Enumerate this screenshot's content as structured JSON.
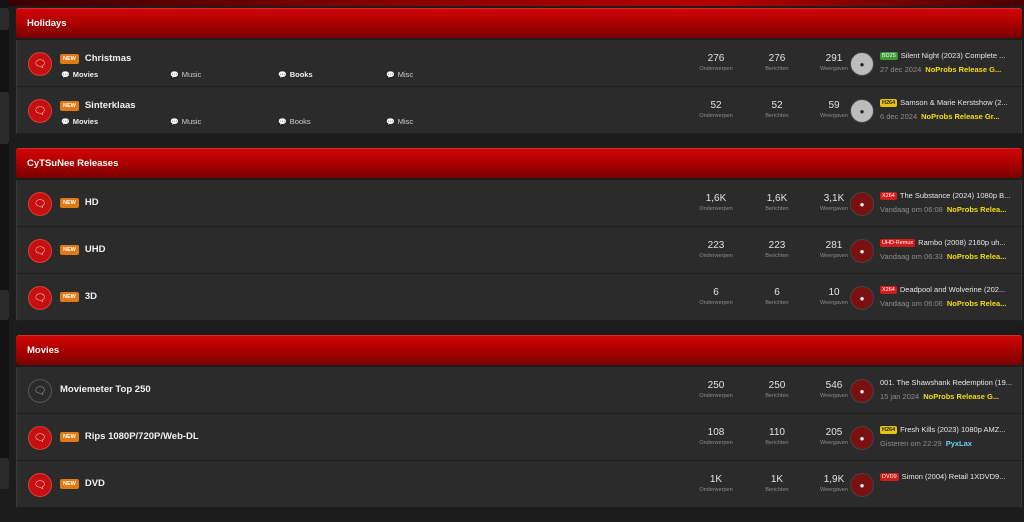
{
  "labels": {
    "topics": "Onderwerpen",
    "posts": "Berichten",
    "views": "Weergaven"
  },
  "categories": [
    {
      "title": "Holidays",
      "nodes": [
        {
          "title": "Christmas",
          "new": "NEW",
          "topics": "276",
          "posts": "276",
          "views": "291",
          "subforums": [
            {
              "label": "Movies",
              "bold": true
            },
            {
              "label": "Music",
              "bold": false
            },
            {
              "label": "Books",
              "bold": true
            },
            {
              "label": "Misc",
              "bold": false
            }
          ],
          "latest": {
            "tag": "BD25",
            "tag_color": "green",
            "title": "Silent Night (2023) Complete ...",
            "date": "27 dec 2024",
            "user": "NoProbs Release G...",
            "user_color": "yellow"
          }
        },
        {
          "title": "Sinterklaas",
          "new": "NEW",
          "topics": "52",
          "posts": "52",
          "views": "59",
          "subforums": [
            {
              "label": "Movies",
              "bold": true
            },
            {
              "label": "Music",
              "bold": false
            },
            {
              "label": "Books",
              "bold": false
            },
            {
              "label": "Misc",
              "bold": false
            }
          ],
          "latest": {
            "tag": "H264",
            "tag_color": "yellow",
            "title": "Samson & Marie Kerstshow (2...",
            "date": "6 dec 2024",
            "user": "NoProbs Release Gr...",
            "user_color": "yellow"
          }
        }
      ]
    },
    {
      "title": "CyTSuNee Releases",
      "nodes": [
        {
          "title": "HD",
          "new": "NEW",
          "topics": "1,6K",
          "posts": "1,6K",
          "views": "3,1K",
          "latest": {
            "tag": "X264",
            "tag_color": "red",
            "title": "The Substance (2024) 1080p B...",
            "date": "Vandaag om 06:08",
            "user": "NoProbs Relea...",
            "user_color": "yellow"
          }
        },
        {
          "title": "UHD",
          "new": "NEW",
          "topics": "223",
          "posts": "223",
          "views": "281",
          "latest": {
            "tag": "UHD-Remux",
            "tag_color": "red",
            "title": "Rambo (2008) 2160p uh...",
            "date": "Vandaag om 06:33",
            "user": "NoProbs Relea...",
            "user_color": "yellow"
          }
        },
        {
          "title": "3D",
          "new": "NEW",
          "topics": "6",
          "posts": "6",
          "views": "10",
          "latest": {
            "tag": "X264",
            "tag_color": "red",
            "title": "Deadpool and Wolverine (202...",
            "date": "Vandaag om 06:06",
            "user": "NoProbs Relea...",
            "user_color": "yellow"
          }
        }
      ]
    },
    {
      "title": "Movies",
      "nodes": [
        {
          "title": "Moviemeter Top 250",
          "new": "",
          "topics": "250",
          "posts": "250",
          "views": "546",
          "latest": {
            "tag": "",
            "tag_color": "",
            "title": "001. The Shawshank Redemption (19...",
            "date": "15 jan 2024",
            "user": "NoProbs Release G...",
            "user_color": "yellow"
          }
        },
        {
          "title": "Rips 1080P/720P/Web-DL",
          "new": "NEW",
          "topics": "108",
          "posts": "110",
          "views": "205",
          "latest": {
            "tag": "H264",
            "tag_color": "yellow",
            "title": "Fresh Kills (2023) 1080p AMZ...",
            "date": "Gisteren om 22:29",
            "user": "PyxLax",
            "user_color": "cyan"
          }
        },
        {
          "title": "DVD",
          "new": "NEW",
          "topics": "1K",
          "posts": "1K",
          "views": "1,9K",
          "latest": {
            "tag": "DVD9",
            "tag_color": "red",
            "title": "Simon (2004) Retail 1XDVD9...",
            "date": "",
            "user": "",
            "user_color": "yellow"
          }
        }
      ]
    }
  ]
}
